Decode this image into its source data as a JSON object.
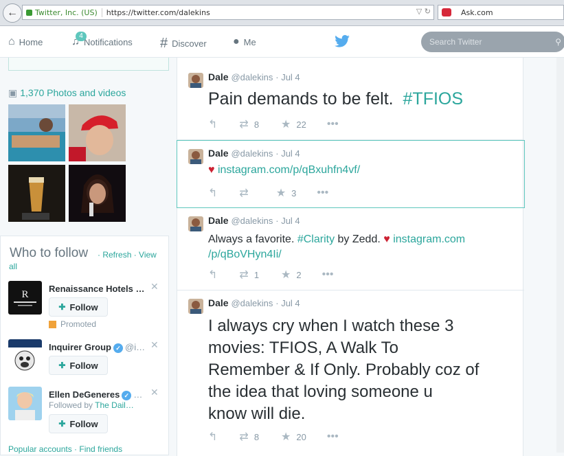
{
  "browser": {
    "site_identity": "Twitter, Inc. (US)",
    "url": "https://twitter.com/dalekins",
    "search_engine": "Ask.com"
  },
  "nav": {
    "home": "Home",
    "notifications": "Notifications",
    "notifications_count": "4",
    "discover": "Discover",
    "me": "Me",
    "search_placeholder": "Search Twitter"
  },
  "sidebar": {
    "photos_label": "1,370 Photos and videos",
    "who_to_follow": {
      "title": "Who to follow",
      "refresh": "Refresh",
      "view_all_a": "· View",
      "view_all_b": "all",
      "dot": "·",
      "accounts": [
        {
          "name": "Renaissance Hotels …",
          "handle": "",
          "follow": "Follow",
          "promoted": "Promoted"
        },
        {
          "name": "Inquirer Group",
          "handle": "@i…",
          "follow": "Follow"
        },
        {
          "name": "Ellen DeGeneres",
          "handle": "…",
          "follow": "Follow",
          "followed_by_prefix": "Followed by",
          "followed_by": "The Dail…"
        }
      ]
    },
    "footer_links": "Popular accounts · Find friends"
  },
  "tweets": [
    {
      "name": "Dale",
      "handle": "@dalekins",
      "date": "· Jul 4",
      "text": "Pain demands to be felt.",
      "hashtag": "#TFIOS",
      "retweets": "8",
      "favorites": "22"
    },
    {
      "name": "Dale",
      "handle": "@dalekins",
      "date": "· Jul 4",
      "heart": "♥",
      "link": "instagram.com/p/qBxuhfn4vf/",
      "retweets": "",
      "favorites": "3"
    },
    {
      "name": "Dale",
      "handle": "@dalekins",
      "date": "· Jul 4",
      "text_a": "Always a favorite.",
      "hashtag": "#Clarity",
      "text_b": "by Zedd.",
      "heart": "♥",
      "link_a": "instagram.com",
      "link_b": "/p/qBoVHyn4Ii/",
      "retweets": "1",
      "favorites": "2"
    },
    {
      "name": "Dale",
      "handle": "@dalekins",
      "date": "· Jul 4",
      "lines": [
        "I always cry when I watch these 3",
        "movies: TFIOS, A Walk To",
        "Remember & If Only. Probably coz of",
        "the idea that loving someone u",
        "know will die."
      ],
      "retweets": "8",
      "favorites": "20"
    }
  ],
  "icons": {
    "back": "back-arrow-icon",
    "camera": "camera-icon",
    "reply": "reply-icon",
    "retweet": "retweet-icon",
    "favorite": "star-icon",
    "more": "more-icon"
  },
  "colors": {
    "accent": "#2ba69c",
    "twitter_blue": "#55acee",
    "heart": "#cc2233"
  }
}
